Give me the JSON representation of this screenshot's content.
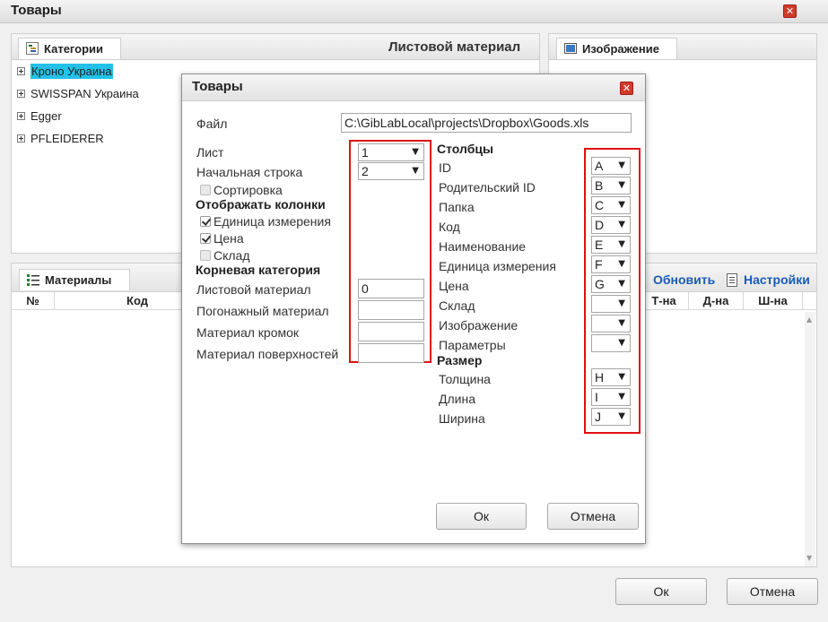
{
  "window": {
    "title": "Товары"
  },
  "categories": {
    "tab_label": "Категории",
    "header_title": "Листовой материал",
    "items": [
      {
        "label": "Кроно Украина",
        "selected": true
      },
      {
        "label": "SWISSPAN Украина",
        "selected": false
      },
      {
        "label": "Egger",
        "selected": false
      },
      {
        "label": "PFLEIDERER",
        "selected": false
      }
    ]
  },
  "image_panel": {
    "tab_label": "Изображение"
  },
  "materials": {
    "tab_label": "Материалы",
    "refresh_label": "Обновить",
    "settings_label": "Настройки",
    "columns": [
      "№",
      "Код",
      "Т-на",
      "Д-на",
      "Ш-на"
    ]
  },
  "main_buttons": {
    "ok": "Ок",
    "cancel": "Отмена"
  },
  "dialog": {
    "title": "Товары",
    "file_label": "Файл",
    "file_value": "C:\\GibLabLocal\\projects\\Dropbox\\Goods.xls",
    "sheet_label": "Лист",
    "sheet_value": "1",
    "start_row_label": "Начальная строка",
    "start_row_value": "2",
    "sort_label": "Сортировка",
    "sort_checked": false,
    "show_columns_title": "Отображать колонки",
    "show_columns": [
      {
        "label": "Единица измерения",
        "checked": true
      },
      {
        "label": "Цена",
        "checked": true
      },
      {
        "label": "Склад",
        "checked": false
      }
    ],
    "root_category_title": "Корневая категория",
    "root_categories": [
      {
        "label": "Листовой материал",
        "value": "0"
      },
      {
        "label": "Погонажный материал",
        "value": ""
      },
      {
        "label": "Материал кромок",
        "value": ""
      },
      {
        "label": "Материал поверхностей",
        "value": ""
      }
    ],
    "columns_title": "Столбцы",
    "columns": [
      {
        "label": "ID",
        "value": "A"
      },
      {
        "label": "Родительский ID",
        "value": "B"
      },
      {
        "label": "Папка",
        "value": "C"
      },
      {
        "label": "Код",
        "value": "D"
      },
      {
        "label": "Наименование",
        "value": "E"
      },
      {
        "label": "Единица измерения",
        "value": "F"
      },
      {
        "label": "Цена",
        "value": "G"
      },
      {
        "label": "Склад",
        "value": ""
      },
      {
        "label": "Изображение",
        "value": ""
      },
      {
        "label": "Параметры",
        "value": ""
      }
    ],
    "size_title": "Размер",
    "size_columns": [
      {
        "label": "Толщина",
        "value": "H"
      },
      {
        "label": "Длина",
        "value": "I"
      },
      {
        "label": "Ширина",
        "value": "J"
      }
    ],
    "ok": "Ок",
    "cancel": "Отмена"
  },
  "icons": {
    "close": "close-icon",
    "categories": "tree-icon",
    "image": "image-icon",
    "materials": "list-icon",
    "refresh": "refresh-icon",
    "settings": "document-icon",
    "dropdown": "chevron-down-icon",
    "expand": "plus-icon"
  },
  "colors": {
    "selection": "#22c2e8",
    "close_button": "#d23a2a",
    "highlight_frame": "#e01010",
    "link": "#1a5bb5"
  }
}
